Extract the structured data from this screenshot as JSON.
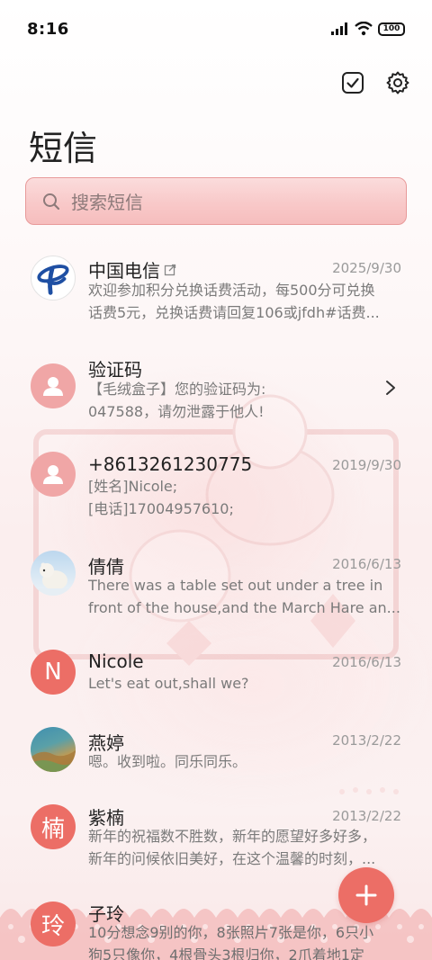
{
  "status": {
    "time": "8:16",
    "battery": "100"
  },
  "header": {
    "title": "短信",
    "icons": [
      "checkbox-select-icon",
      "settings-gear-icon"
    ]
  },
  "search": {
    "placeholder": "搜索短信"
  },
  "conversations": [
    {
      "name": "中国电信",
      "date": "2025/9/30",
      "lines": [
        "欢迎参加积分兑换话费活动，每500分可兑换",
        "话费5元，兑换话费请回复106或jfdh#话费..."
      ],
      "avatar": "china-telecom-logo"
    },
    {
      "name": "验证码",
      "date": "",
      "lines": [
        "【毛绒盒子】您的验证码为:",
        "047588，请勿泄露于他人!"
      ],
      "avatar": "contact-placeholder"
    },
    {
      "name": "+8613261230775",
      "date": "2019/9/30",
      "lines": [
        "[姓名]Nicole;",
        "[电话]17004957610;"
      ],
      "avatar": "contact-placeholder"
    },
    {
      "name": "倩倩",
      "date": "2016/6/13",
      "lines": [
        "There was a table set out under a tree in",
        "front of the house,and the March Hare an..."
      ],
      "avatar": "polar-bear-photo"
    },
    {
      "name": "Nicole",
      "date": "2016/6/13",
      "lines": [
        "Let's eat out,shall we?"
      ],
      "avatar_letter": "N"
    },
    {
      "name": "燕婷",
      "date": "2013/2/22",
      "lines": [
        "嗯。收到啦。同乐同乐。"
      ],
      "avatar": "landscape-photo"
    },
    {
      "name": "紫楠",
      "date": "2013/2/22",
      "lines": [
        "新年的祝福数不胜数，新年的愿望好多好多，",
        "新年的问候依旧美好，在这个温馨的时刻，..."
      ],
      "avatar_letter": "楠"
    },
    {
      "name": "子玲",
      "date": "",
      "lines": [
        "10分想念9别的你，8张照片7张是你，6只小",
        "狗5只像你，4根骨头3根归你，2爪着地1定"
      ],
      "avatar_letter": "玲"
    }
  ],
  "colors": {
    "accent": "#ec6e66",
    "search_bg": "#f8c9c9",
    "search_border": "#e89a9a"
  }
}
